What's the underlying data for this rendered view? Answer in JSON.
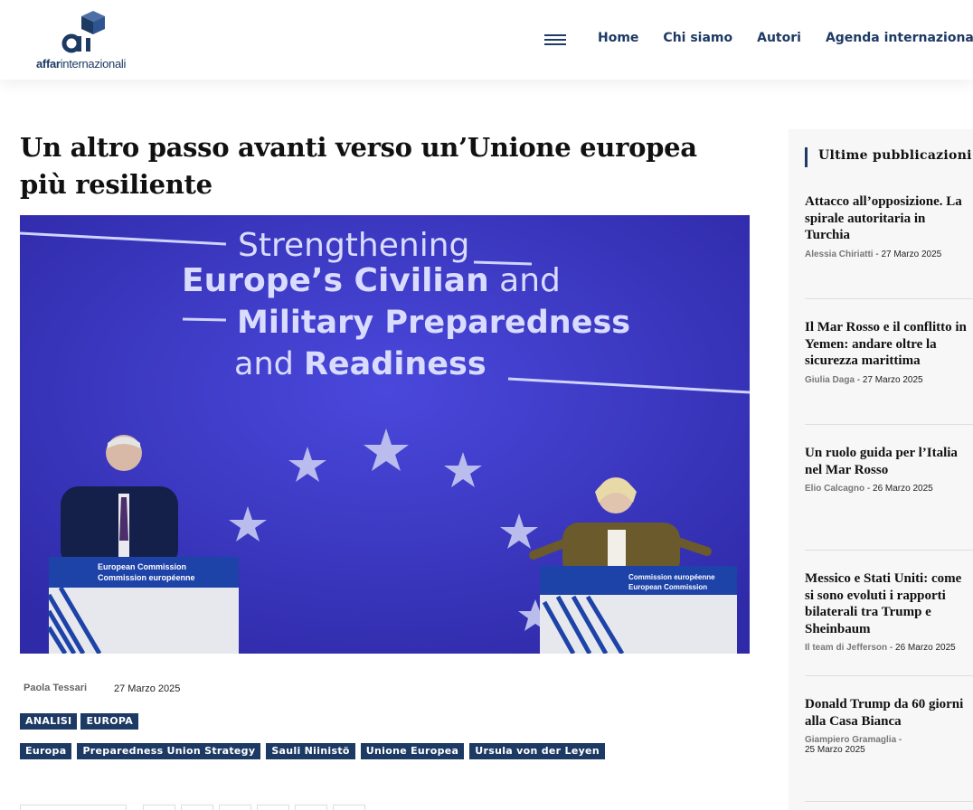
{
  "header": {
    "logo_bold": "affar",
    "logo_rest": "internazionali",
    "nav": [
      "Home",
      "Chi siamo",
      "Autori",
      "Agenda internazionale"
    ]
  },
  "article": {
    "title": "Un altro passo avanti verso un’Unione europea più resiliente",
    "author": "Paola Tessari",
    "date": "27 Marzo 2025",
    "categories": [
      "ANALISI",
      "EUROPA"
    ],
    "tags": [
      "Europa",
      "Preparedness Union Strategy",
      "Sauli Niinistö",
      "Unione Europea",
      "Ursula von der Leyen"
    ]
  },
  "hero": {
    "line1": "Strengthening",
    "line2_bold": "Europe’s Civilian",
    "line2_rest": " and",
    "line3_bold": "Military Preparedness",
    "line4_rest": "and ",
    "line4_bold": "Readiness",
    "podium_left_1": "European Commission",
    "podium_left_2": "Commission européenne",
    "podium_right_1": "Commission européenne",
    "podium_right_2": "European Commission"
  },
  "sidebar": {
    "heading": "Ultime pubblicazioni",
    "posts": [
      {
        "title": "Attacco all’opposizione. La spirale autoritaria in Turchia",
        "author": "Alessia Chiriatti",
        "date": "27 Marzo 2025"
      },
      {
        "title": "Il Mar Rosso e il conflitto in Yemen: andare oltre la sicurezza marittima",
        "author": "Giulia Daga",
        "date": "27 Marzo 2025"
      },
      {
        "title": "Un ruolo guida per l’Italia nel Mar Rosso",
        "author": "Elio Calcagno",
        "date": "26 Marzo 2025"
      },
      {
        "title": "Messico e Stati Uniti: come si sono evoluti i rapporti bilaterali tra Trump e Sheinbaum",
        "author": "Il team di Jefferson",
        "date": "26 Marzo 2025"
      },
      {
        "title": "Donald Trump da 60 giorni alla Casa Bianca",
        "author": "Giampiero Gramaglia",
        "date": "25 Marzo 2025"
      }
    ]
  },
  "colors": {
    "brand": "#1d3a64",
    "hero_bg": "#3a36c9"
  }
}
